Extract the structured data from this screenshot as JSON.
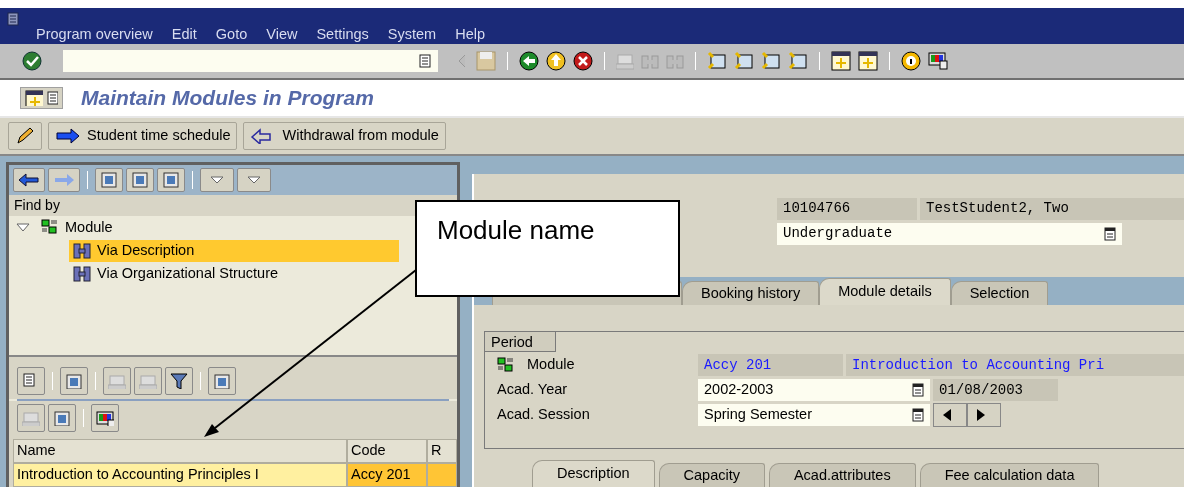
{
  "menu_bar": [
    {
      "label": "Program overview"
    },
    {
      "label": "Edit"
    },
    {
      "label": "Goto"
    },
    {
      "label": "View"
    },
    {
      "label": "Settings"
    },
    {
      "label": "System"
    },
    {
      "label": "Help"
    }
  ],
  "title": "Maintain Modules in Program",
  "app_toolbar": {
    "buttons": [
      "Student time schedule",
      "Withdrawal from module"
    ]
  },
  "tree": {
    "header": "Find by",
    "nodes": [
      {
        "label": "Module",
        "expanded": true,
        "selected": false,
        "children": [
          {
            "label": "Via Description",
            "selected": true
          },
          {
            "label": "Via Organizational Structure",
            "selected": false
          }
        ]
      }
    ]
  },
  "hit_list": {
    "columns": [
      "Name",
      "Code",
      "R"
    ],
    "rows": [
      {
        "cells": [
          "Introduction to Accounting Principles I",
          "Accy 201"
        ],
        "selected": true
      }
    ]
  },
  "header_fields": {
    "student_number": "10104766",
    "student_name": "TestStudent2, Two",
    "program_type": "Undergraduate"
  },
  "covered_tab": {
    "selected": false
  },
  "tabs": [
    {
      "label": "Booking history",
      "selected": false
    },
    {
      "label": "Module details",
      "selected": true
    },
    {
      "label": "Selection",
      "selected": false
    }
  ],
  "period": {
    "title": "Period",
    "fields": [
      {
        "label": "Module",
        "kind": "module",
        "code": "Accy 201",
        "name": "Introduction to Accounting Pri"
      },
      {
        "label": "Acad. Year",
        "kind": "dropdown",
        "value": "2002-2003",
        "extra": "01/08/2003"
      },
      {
        "label": "Acad. Session",
        "kind": "stepper",
        "value": "Spring Semester"
      }
    ]
  },
  "detail_tabs": [
    {
      "label": "Description",
      "selected": true
    },
    {
      "label": "Capacity",
      "selected": false
    },
    {
      "label": "Acad.attributes",
      "selected": false
    },
    {
      "label": "Fee calculation data",
      "selected": false
    }
  ],
  "callout": {
    "text": "Module name"
  }
}
